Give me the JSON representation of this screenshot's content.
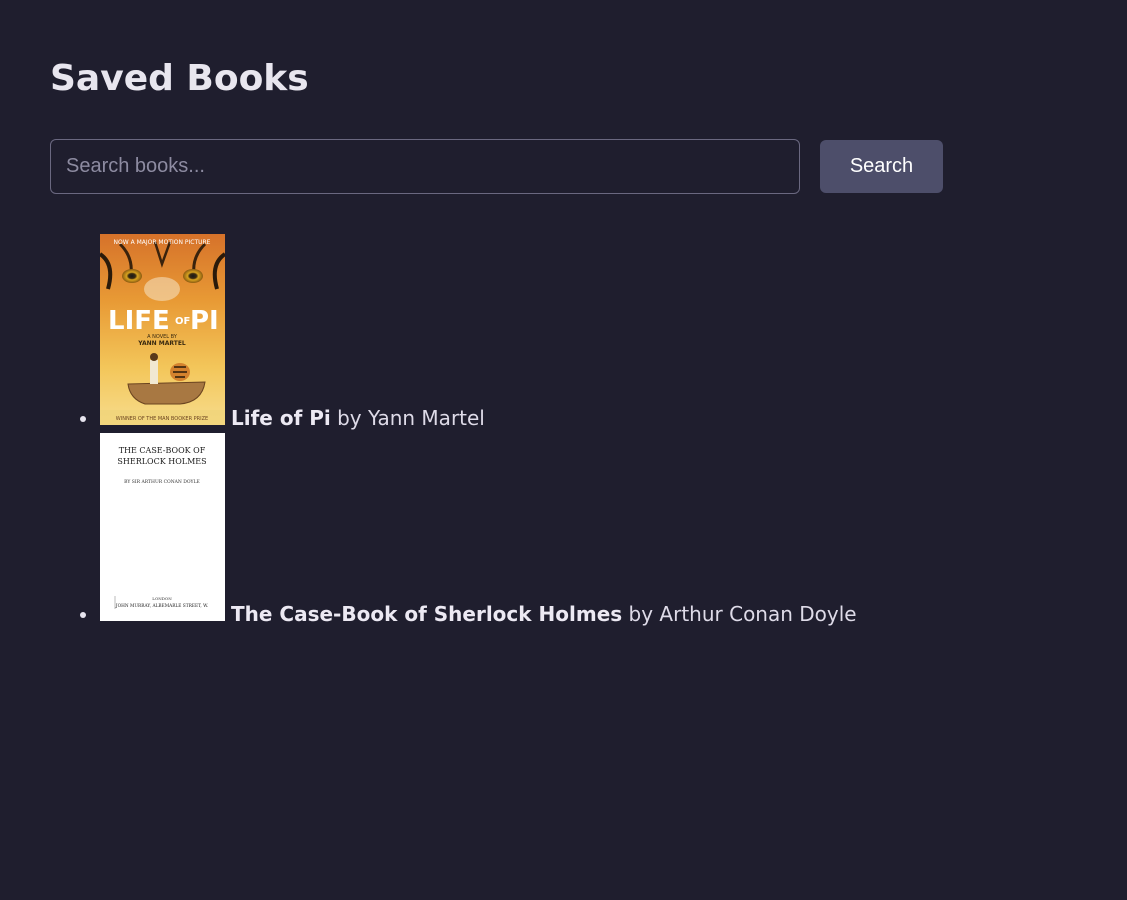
{
  "page": {
    "title": "Saved Books"
  },
  "search": {
    "placeholder": "Search books...",
    "value": "",
    "button_label": "Search"
  },
  "books": [
    {
      "title": "Life of Pi",
      "by_prefix": "by",
      "author": "Yann Martel",
      "cover": {
        "top_text": "NOW A MAJOR MOTION PICTURE",
        "title_left": "LIFE",
        "title_of": "OF",
        "title_right": "PI",
        "sub": "A NOVEL BY",
        "author": "YANN MARTEL",
        "bottom_text": "WINNER OF THE MAN BOOKER PRIZE"
      }
    },
    {
      "title": "The Case-Book of Sherlock Holmes",
      "by_prefix": "by",
      "author": "Arthur Conan Doyle",
      "cover": {
        "line1": "THE CASE-BOOK OF",
        "line2": "SHERLOCK HOLMES",
        "byline": "BY SIR ARTHUR CONAN DOYLE",
        "pub1": "LONDON",
        "pub2": "JOHN MURRAY, ALBEMARLE STREET, W."
      }
    }
  ],
  "colors": {
    "background": "#1f1e2e",
    "button": "#4d4e6a",
    "text": "#e6e4ee"
  }
}
